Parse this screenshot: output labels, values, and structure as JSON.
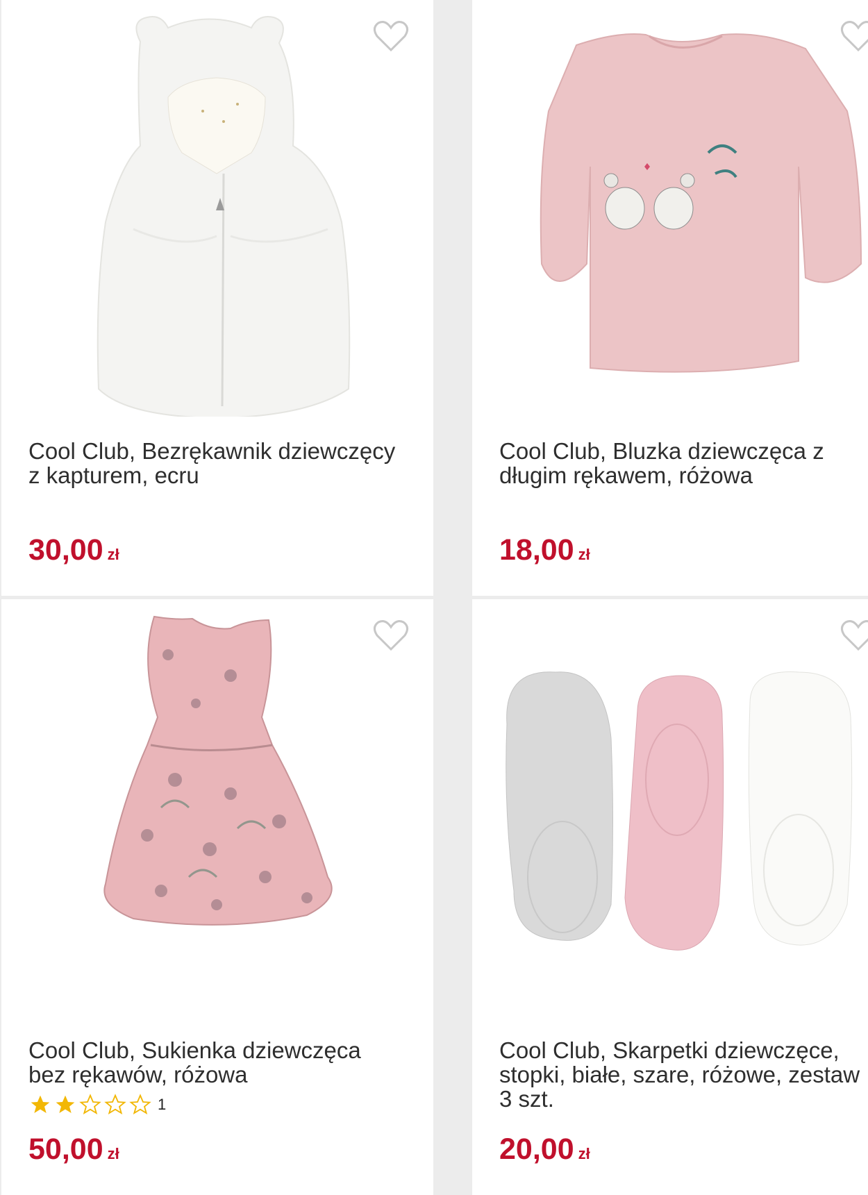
{
  "products": [
    {
      "title_line1": "Cool Club, Bezrękawnik dziewczęcy",
      "title_line2": "z kapturem, ecru",
      "price": "30,00",
      "currency": "zł",
      "image": "white-fur-hooded-vest",
      "favorite_icon": "heart-outline-icon"
    },
    {
      "title_line1": "Cool Club, Bluzka dziewczęca z",
      "title_line2": "długim rękawem, różowa",
      "price": "18,00",
      "currency": "zł",
      "image": "pink-long-sleeve-blouse-mice-print",
      "favorite_icon": "heart-outline-icon"
    },
    {
      "title_line1": "Cool Club, Sukienka dziewczęca",
      "title_line2": "bez rękawów, różowa",
      "price": "50,00",
      "currency": "zł",
      "rating": 2,
      "rating_max": 5,
      "review_count": "1",
      "image": "pink-floral-sleeveless-dress",
      "favorite_icon": "heart-outline-icon"
    },
    {
      "title_line1": "Cool Club, Skarpetki dziewczęce,",
      "title_line2": "stopki, białe, szare, różowe, zestaw",
      "title_line3": "3 szt.",
      "price": "20,00",
      "currency": "zł",
      "image": "no-show-socks-set-grey-pink-white",
      "favorite_icon": "heart-outline-icon"
    }
  ],
  "colors": {
    "price": "#c0102c",
    "star_filled": "#f2b705",
    "star_empty": "#f2b705",
    "background": "#ececec",
    "card": "#ffffff"
  }
}
